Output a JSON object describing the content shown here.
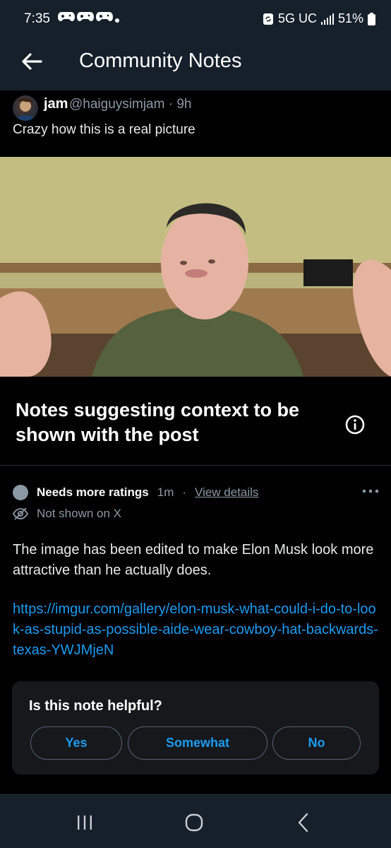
{
  "status_bar": {
    "time": "7:35",
    "network": "5G UC",
    "battery": "51%"
  },
  "header": {
    "title": "Community Notes"
  },
  "post": {
    "author_name": "jam",
    "author_handle": "@haiguysimjam · 9h",
    "text": "Crazy how this is a real picture"
  },
  "notes_section": {
    "heading": "Notes suggesting context to be shown with the post"
  },
  "note": {
    "status_label": "Needs more ratings",
    "time": "1m",
    "separator": "·",
    "view_details": "View details",
    "not_shown": "Not shown on X",
    "body": "The image has been edited to make Elon Musk look more attractive than he actually does.",
    "link": "https://imgur.com/gallery/elon-musk-what-could-i-do-to-look-as-stupid-as-possible-aide-wear-cowboy-hat-backwards-texas-YWJMjeN"
  },
  "helpful": {
    "question": "Is this note helpful?",
    "yes": "Yes",
    "somewhat": "Somewhat",
    "no": "No"
  },
  "colors": {
    "accent": "#1d9bf0",
    "header_bg": "#15202b",
    "status_gray": "#8b98a5"
  }
}
